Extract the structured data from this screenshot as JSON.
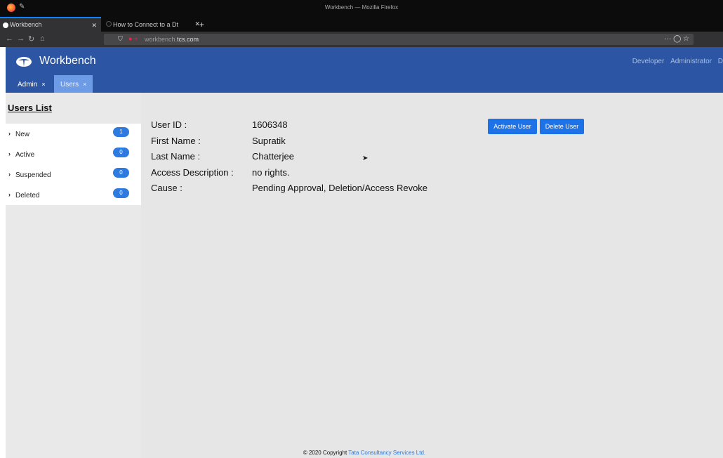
{
  "browser": {
    "window_title": "Workbench — Mozilla Firefox",
    "tabs": [
      {
        "label": "Workbench",
        "active": true
      },
      {
        "label": "How to Connect to a Dt",
        "active": false
      }
    ],
    "url_prefix": "workbench.",
    "url_domain": "tcs.com",
    "icons": [
      "firefox-icon",
      "back-icon",
      "forward-icon",
      "reload-icon",
      "home-icon",
      "shield-icon",
      "lock-icon",
      "more-icon",
      "pocket-icon",
      "star-icon"
    ]
  },
  "app": {
    "brand": "Workbench",
    "header_links": [
      "Developer",
      "Administrator",
      "D"
    ],
    "tabs": [
      {
        "label": "Admin"
      },
      {
        "label": "Users"
      }
    ],
    "colors": {
      "header": "#2c56a4",
      "button": "#1d72e8",
      "badge": "#2d7be0"
    }
  },
  "sidebar": {
    "title": "Users List",
    "items": [
      {
        "label": "New",
        "count": "1"
      },
      {
        "label": "Active",
        "count": "0"
      },
      {
        "label": "Suspended",
        "count": "0"
      },
      {
        "label": "Deleted",
        "count": "0"
      }
    ]
  },
  "user": {
    "fields": [
      {
        "label": "User ID :",
        "value": "1606348"
      },
      {
        "label": "First Name :",
        "value": "Supratik"
      },
      {
        "label": "Last Name :",
        "value": "Chatterjee"
      },
      {
        "label": "Access Description :",
        "value": "no rights."
      },
      {
        "label": "Cause :",
        "value": "Pending Approval, Deletion/Access Revoke"
      }
    ]
  },
  "actions": {
    "activate_label": "Activate User",
    "delete_label": "Delete User"
  },
  "footer": {
    "prefix": "© 2020 Copyright ",
    "company": "Tata Consultancy Services Ltd."
  }
}
